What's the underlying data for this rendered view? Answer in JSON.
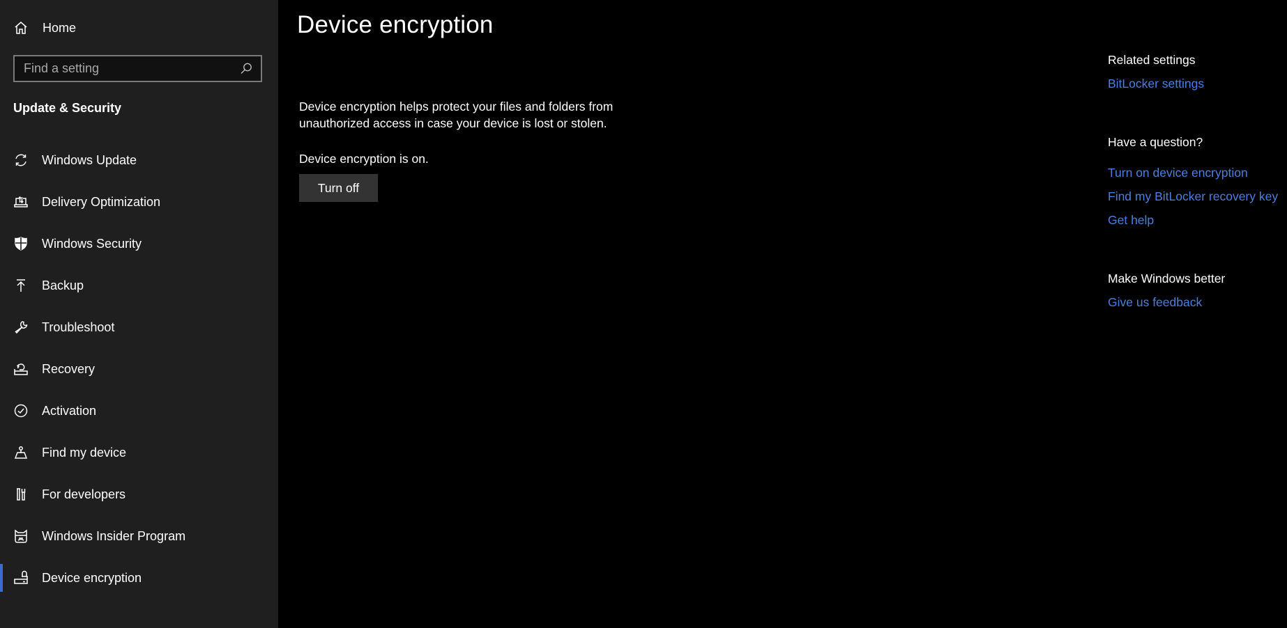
{
  "sidebar": {
    "home_label": "Home",
    "search_placeholder": "Find a setting",
    "search_value": "",
    "section_title": "Update & Security",
    "accent_color": "#3b6bd6",
    "items": [
      {
        "label": "Windows Update",
        "icon": "sync-icon",
        "active": false
      },
      {
        "label": "Delivery Optimization",
        "icon": "delivery-optimization-icon",
        "active": false
      },
      {
        "label": "Windows Security",
        "icon": "shield-icon",
        "active": false
      },
      {
        "label": "Backup",
        "icon": "upload-arrow-icon",
        "active": false
      },
      {
        "label": "Troubleshoot",
        "icon": "wrench-icon",
        "active": false
      },
      {
        "label": "Recovery",
        "icon": "recovery-icon",
        "active": false
      },
      {
        "label": "Activation",
        "icon": "checkmark-circle-icon",
        "active": false
      },
      {
        "label": "Find my device",
        "icon": "find-device-icon",
        "active": false
      },
      {
        "label": "For developers",
        "icon": "developer-tools-icon",
        "active": false
      },
      {
        "label": "Windows Insider Program",
        "icon": "ninja-cat-icon",
        "active": false
      },
      {
        "label": "Device encryption",
        "icon": "drive-lock-icon",
        "active": true
      }
    ]
  },
  "main": {
    "title": "Device encryption",
    "description": "Device encryption helps protect your files and folders from unauthorized access in case your device is lost or stolen.",
    "status": "Device encryption is on.",
    "turn_off_label": "Turn off"
  },
  "right": {
    "related_heading": "Related settings",
    "related_links": [
      "BitLocker settings"
    ],
    "question_heading": "Have a question?",
    "question_links": [
      "Turn on device encryption",
      "Find my BitLocker recovery key",
      "Get help"
    ],
    "better_heading": "Make Windows better",
    "better_links": [
      "Give us feedback"
    ],
    "link_color": "#4a7fe0"
  }
}
